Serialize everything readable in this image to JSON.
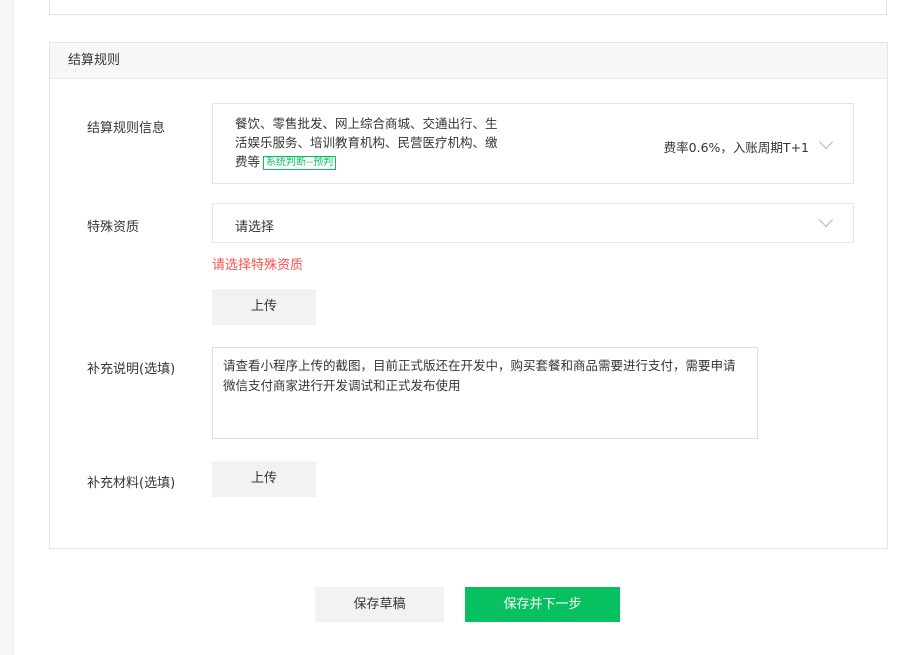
{
  "section": {
    "title": "结算规则"
  },
  "settlement_rule": {
    "label": "结算规则信息",
    "line1": "餐饮、零售批发、网上综合商城、交通出行、生",
    "line2": "活娱乐服务、培训教育机构、民营医疗机构、缴",
    "line3": "费等",
    "tag": "系统判断--预判",
    "fee": "费率0.6%，入账周期T+1"
  },
  "special_qualification": {
    "label": "特殊资质",
    "placeholder": "请选择",
    "error": "请选择特殊资质",
    "upload_label": "上传"
  },
  "supplement_note": {
    "label": "补充说明(选填)",
    "value": "请查看小程序上传的截图，目前正式版还在开发中，购买套餐和商品需要进行支付，需要申请微信支付商家进行开发调试和正式发布使用"
  },
  "supplement_material": {
    "label": "补充材料(选填)",
    "upload_label": "上传"
  },
  "actions": {
    "save_draft": "保存草稿",
    "save_next": "保存并下一步"
  },
  "colors": {
    "accent": "#07c160",
    "error": "#fa5151"
  },
  "icons": [
    "chevron-down-icon"
  ]
}
